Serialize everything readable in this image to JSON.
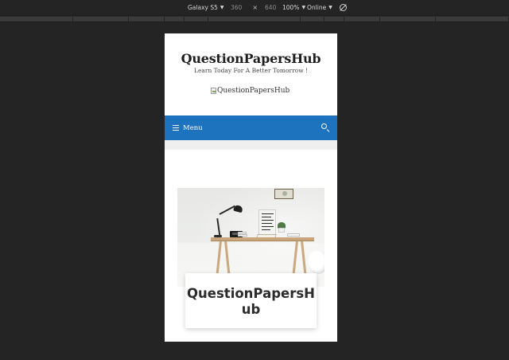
{
  "devtools": {
    "device": "Galaxy S5",
    "width": "360",
    "height": "640",
    "separator": "×",
    "zoom": "100%",
    "network": "Online",
    "icons": {
      "caret": "chevron-down-icon",
      "rotate": "rotate-icon"
    }
  },
  "site": {
    "title": "QuestionPapersHub",
    "tagline": "Learn Today For A Better Tomorrow !",
    "logo_alt": "QuestionPapersHub"
  },
  "nav": {
    "menu_label": "Menu",
    "background": "#1e73be",
    "icons": {
      "menu": "hamburger-icon",
      "search": "search-icon"
    }
  },
  "post": {
    "title_line1": "QuestionPapersH",
    "title_line2": "ub",
    "image": "desk-workspace-photo"
  }
}
